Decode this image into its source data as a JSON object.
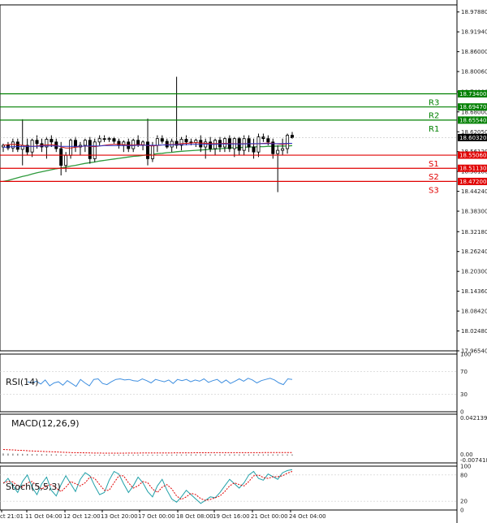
{
  "chart_data": {
    "type": "candlestick",
    "price_ticks": [
      "18.97880",
      "18.91940",
      "18.86000",
      "18.80060",
      "18.74000",
      "18.68000",
      "18.62050",
      "18.56120",
      "18.50180",
      "18.44240",
      "18.38300",
      "18.32180",
      "18.26240",
      "18.20300",
      "18.14360",
      "18.08420",
      "18.02480",
      "17.96540"
    ],
    "price_range": [
      17.9654,
      19.0
    ],
    "current_price": "18.60320",
    "levels": [
      {
        "name": "R3",
        "value": 18.734,
        "label": "18.73400",
        "color": "#008000"
      },
      {
        "name": "R2",
        "value": 18.6947,
        "label": "18.69470",
        "color": "#008000"
      },
      {
        "name": "R1",
        "value": 18.6554,
        "label": "18.65540",
        "color": "#008000"
      },
      {
        "name": "S1",
        "value": 18.5506,
        "label": "18.55060",
        "color": "#e00000"
      },
      {
        "name": "S2",
        "value": 18.5113,
        "label": "18.51130",
        "color": "#e00000"
      },
      {
        "name": "S3",
        "value": 18.472,
        "label": "18.47200",
        "color": "#e00000"
      }
    ],
    "candles": [
      {
        "o": 18.575,
        "h": 18.585,
        "l": 18.56,
        "c": 18.58
      },
      {
        "o": 18.58,
        "h": 18.59,
        "l": 18.565,
        "c": 18.572
      },
      {
        "o": 18.572,
        "h": 18.6,
        "l": 18.56,
        "c": 18.59
      },
      {
        "o": 18.59,
        "h": 18.6,
        "l": 18.56,
        "c": 18.568
      },
      {
        "o": 18.568,
        "h": 18.658,
        "l": 18.52,
        "c": 18.58
      },
      {
        "o": 18.58,
        "h": 18.6,
        "l": 18.55,
        "c": 18.56
      },
      {
        "o": 18.56,
        "h": 18.6,
        "l": 18.545,
        "c": 18.595
      },
      {
        "o": 18.595,
        "h": 18.61,
        "l": 18.57,
        "c": 18.585
      },
      {
        "o": 18.585,
        "h": 18.6,
        "l": 18.56,
        "c": 18.575
      },
      {
        "o": 18.575,
        "h": 18.605,
        "l": 18.54,
        "c": 18.598
      },
      {
        "o": 18.598,
        "h": 18.61,
        "l": 18.575,
        "c": 18.59
      },
      {
        "o": 18.59,
        "h": 18.6,
        "l": 18.56,
        "c": 18.57
      },
      {
        "o": 18.57,
        "h": 18.59,
        "l": 18.49,
        "c": 18.52
      },
      {
        "o": 18.52,
        "h": 18.56,
        "l": 18.5,
        "c": 18.55
      },
      {
        "o": 18.55,
        "h": 18.6,
        "l": 18.54,
        "c": 18.595
      },
      {
        "o": 18.595,
        "h": 18.605,
        "l": 18.56,
        "c": 18.575
      },
      {
        "o": 18.575,
        "h": 18.59,
        "l": 18.55,
        "c": 18.58
      },
      {
        "o": 18.58,
        "h": 18.6,
        "l": 18.56,
        "c": 18.595
      },
      {
        "o": 18.595,
        "h": 18.605,
        "l": 18.525,
        "c": 18.54
      },
      {
        "o": 18.54,
        "h": 18.6,
        "l": 18.53,
        "c": 18.59
      },
      {
        "o": 18.59,
        "h": 18.61,
        "l": 18.58,
        "c": 18.6
      },
      {
        "o": 18.6,
        "h": 18.61,
        "l": 18.59,
        "c": 18.598
      },
      {
        "o": 18.598,
        "h": 18.605,
        "l": 18.59,
        "c": 18.6
      },
      {
        "o": 18.6,
        "h": 18.605,
        "l": 18.585,
        "c": 18.592
      },
      {
        "o": 18.592,
        "h": 18.6,
        "l": 18.57,
        "c": 18.58
      },
      {
        "o": 18.58,
        "h": 18.595,
        "l": 18.56,
        "c": 18.59
      },
      {
        "o": 18.59,
        "h": 18.6,
        "l": 18.56,
        "c": 18.57
      },
      {
        "o": 18.57,
        "h": 18.6,
        "l": 18.56,
        "c": 18.595
      },
      {
        "o": 18.595,
        "h": 18.61,
        "l": 18.575,
        "c": 18.58
      },
      {
        "o": 18.58,
        "h": 18.595,
        "l": 18.565,
        "c": 18.59
      },
      {
        "o": 18.59,
        "h": 18.66,
        "l": 18.52,
        "c": 18.54
      },
      {
        "o": 18.54,
        "h": 18.59,
        "l": 18.53,
        "c": 18.58
      },
      {
        "o": 18.58,
        "h": 18.61,
        "l": 18.56,
        "c": 18.6
      },
      {
        "o": 18.6,
        "h": 18.61,
        "l": 18.585,
        "c": 18.592
      },
      {
        "o": 18.592,
        "h": 18.6,
        "l": 18.57,
        "c": 18.575
      },
      {
        "o": 18.575,
        "h": 18.6,
        "l": 18.56,
        "c": 18.592
      },
      {
        "o": 18.592,
        "h": 18.785,
        "l": 18.57,
        "c": 18.58
      },
      {
        "o": 18.58,
        "h": 18.605,
        "l": 18.565,
        "c": 18.598
      },
      {
        "o": 18.598,
        "h": 18.61,
        "l": 18.58,
        "c": 18.59
      },
      {
        "o": 18.59,
        "h": 18.6,
        "l": 18.58,
        "c": 18.588
      },
      {
        "o": 18.588,
        "h": 18.6,
        "l": 18.575,
        "c": 18.595
      },
      {
        "o": 18.595,
        "h": 18.61,
        "l": 18.56,
        "c": 18.575
      },
      {
        "o": 18.575,
        "h": 18.6,
        "l": 18.54,
        "c": 18.59
      },
      {
        "o": 18.59,
        "h": 18.605,
        "l": 18.56,
        "c": 18.57
      },
      {
        "o": 18.57,
        "h": 18.6,
        "l": 18.55,
        "c": 18.595
      },
      {
        "o": 18.595,
        "h": 18.605,
        "l": 18.56,
        "c": 18.575
      },
      {
        "o": 18.575,
        "h": 18.605,
        "l": 18.56,
        "c": 18.6
      },
      {
        "o": 18.6,
        "h": 18.61,
        "l": 18.56,
        "c": 18.57
      },
      {
        "o": 18.57,
        "h": 18.605,
        "l": 18.545,
        "c": 18.6
      },
      {
        "o": 18.6,
        "h": 18.605,
        "l": 18.55,
        "c": 18.565
      },
      {
        "o": 18.565,
        "h": 18.61,
        "l": 18.55,
        "c": 18.6
      },
      {
        "o": 18.6,
        "h": 18.61,
        "l": 18.56,
        "c": 18.575
      },
      {
        "o": 18.575,
        "h": 18.6,
        "l": 18.54,
        "c": 18.56
      },
      {
        "o": 18.56,
        "h": 18.615,
        "l": 18.545,
        "c": 18.605
      },
      {
        "o": 18.605,
        "h": 18.615,
        "l": 18.59,
        "c": 18.6
      },
      {
        "o": 18.6,
        "h": 18.61,
        "l": 18.58,
        "c": 18.59
      },
      {
        "o": 18.59,
        "h": 18.6,
        "l": 18.54,
        "c": 18.555
      },
      {
        "o": 18.555,
        "h": 18.58,
        "l": 18.44,
        "c": 18.565
      },
      {
        "o": 18.565,
        "h": 18.6,
        "l": 18.55,
        "c": 18.57
      },
      {
        "o": 18.57,
        "h": 18.615,
        "l": 18.555,
        "c": 18.61
      },
      {
        "o": 18.61,
        "h": 18.62,
        "l": 18.6,
        "c": 18.603
      }
    ],
    "ma_fast": [
      18.58,
      18.582,
      18.583,
      18.582,
      18.58,
      18.578,
      18.577,
      18.578,
      18.58,
      18.581,
      18.582,
      18.58,
      18.575,
      18.572,
      18.572,
      18.574,
      18.576,
      18.578,
      18.577,
      18.576,
      18.578,
      18.58,
      18.582,
      18.583,
      18.583,
      18.582,
      18.581,
      18.581,
      18.582,
      18.582,
      18.579,
      18.578,
      18.579,
      18.581,
      18.582,
      18.582,
      18.583,
      18.585,
      18.586,
      18.587,
      18.588,
      18.587,
      18.586,
      18.585,
      18.585,
      18.585,
      18.586,
      18.585,
      18.585,
      18.584,
      18.585,
      18.585,
      18.584,
      18.585,
      18.586,
      18.587,
      18.586,
      18.584,
      18.583,
      18.585,
      18.586
    ],
    "ma_slow": [
      18.574,
      18.575,
      18.576,
      18.576,
      18.577,
      18.577,
      18.577,
      18.577,
      18.578,
      18.578,
      18.578,
      18.578,
      18.577,
      18.577,
      18.577,
      18.577,
      18.577,
      18.578,
      18.578,
      18.578,
      18.578,
      18.579,
      18.579,
      18.579,
      18.579,
      18.579,
      18.579,
      18.579,
      18.58,
      18.58,
      18.58,
      18.58,
      18.58,
      18.581,
      18.581,
      18.581,
      18.582,
      18.582,
      18.582,
      18.583,
      18.583,
      18.583,
      18.583,
      18.583,
      18.583,
      18.584,
      18.584,
      18.584,
      18.584,
      18.584,
      18.584,
      18.585,
      18.585,
      18.585,
      18.585,
      18.585,
      18.585,
      18.585,
      18.585,
      18.586,
      18.586
    ],
    "ma_long": [
      18.472,
      18.475,
      18.479,
      18.483,
      18.487,
      18.49,
      18.494,
      18.498,
      18.501,
      18.504,
      18.507,
      18.51,
      18.512,
      18.515,
      18.518,
      18.52,
      18.523,
      18.526,
      18.528,
      18.53,
      18.533,
      18.535,
      18.537,
      18.539,
      18.541,
      18.543,
      18.545,
      18.547,
      18.548,
      18.55,
      18.552,
      18.553,
      18.555,
      18.556,
      18.558,
      18.559,
      18.561,
      18.562,
      18.563,
      18.564,
      18.565,
      18.566,
      18.567,
      18.568,
      18.569,
      18.57,
      18.571,
      18.572,
      18.573,
      18.573,
      18.574,
      18.575,
      18.575,
      18.576,
      18.576,
      18.577,
      18.577,
      18.578,
      18.578,
      18.578,
      18.579
    ],
    "x_labels": [
      "ct 21:01",
      "11 Oct 04:00",
      "12 Oct 12:00",
      "13 Oct 20:00",
      "17 Oct 00:00",
      "18 Oct 08:00",
      "19 Oct 16:00",
      "21 Oct 00:00",
      "24 Oct 04:00"
    ],
    "rsi": {
      "title": "RSI(14)",
      "ticks": [
        "100",
        "70",
        "30",
        "0"
      ],
      "tick_values": [
        100,
        70,
        30,
        0
      ],
      "values": [
        52,
        50,
        53,
        48,
        55,
        45,
        50,
        52,
        46,
        54,
        49,
        44,
        56,
        50,
        45,
        56,
        57,
        49,
        47,
        52,
        56,
        57,
        55,
        56,
        54,
        53,
        57,
        54,
        50,
        56,
        54,
        52,
        55,
        49,
        56,
        54,
        56,
        52,
        55,
        53,
        57,
        51,
        54,
        56,
        50,
        55,
        49,
        53,
        57,
        53,
        58,
        55,
        50,
        54,
        56,
        58,
        55,
        50,
        47,
        57,
        56
      ]
    },
    "macd": {
      "title": "MACD(12,26,9)",
      "top_label": "0.042139",
      "zero_label": "0.00",
      "bottom_label": "-0.007418",
      "hist": [
        0.0022,
        0.0021,
        0.002,
        0.0019,
        0.0018,
        0.0017,
        0.0016,
        0.0015,
        0.0015,
        0.0014,
        0.0013,
        0.0012,
        0.001,
        0.0009,
        0.0009,
        0.0009,
        0.0009,
        0.0009,
        0.0008,
        0.0008,
        0.0009,
        0.0009,
        0.001,
        0.001,
        0.001,
        0.001,
        0.001,
        0.001,
        0.001,
        0.001,
        0.0009,
        0.0009,
        0.0009,
        0.001,
        0.001,
        0.001,
        0.0011,
        0.0011,
        0.0011,
        0.0012,
        0.0012,
        0.0012,
        0.0012,
        0.0012,
        0.0012,
        0.0012,
        0.0012,
        0.0012,
        0.0012,
        0.0012,
        0.0012,
        0.0012,
        0.0012,
        0.0012,
        0.0012,
        0.0012,
        0.0012,
        0.0012,
        0.0012,
        0.0012,
        0.0012
      ],
      "signal": [
        0.0062,
        0.006,
        0.0058,
        0.0055,
        0.0053,
        0.005,
        0.0047,
        0.0045,
        0.0043,
        0.0041,
        0.0039,
        0.0037,
        0.0035,
        0.0033,
        0.0031,
        0.003,
        0.0029,
        0.0028,
        0.0027,
        0.0026,
        0.0026,
        0.0025,
        0.0025,
        0.0025,
        0.0025,
        0.0025,
        0.0026,
        0.0026,
        0.0026,
        0.0027,
        0.0027,
        0.0027,
        0.0027,
        0.0027,
        0.0027,
        0.0027,
        0.0028,
        0.0028,
        0.0028,
        0.0028,
        0.0029,
        0.0029,
        0.0029,
        0.003,
        0.003,
        0.003,
        0.003,
        0.003,
        0.003,
        0.003,
        0.003,
        0.003,
        0.003,
        0.003,
        0.0031,
        0.0031,
        0.0031,
        0.0031,
        0.0031,
        0.0031,
        0.0031
      ]
    },
    "stoch": {
      "title": "Stoch(5,5,3)",
      "ticks": [
        "100",
        "80",
        "20",
        "0"
      ],
      "tick_values": [
        100,
        80,
        20,
        0
      ],
      "k": [
        60,
        72,
        55,
        40,
        65,
        80,
        52,
        35,
        60,
        75,
        45,
        32,
        58,
        78,
        60,
        42,
        70,
        85,
        78,
        55,
        35,
        40,
        68,
        88,
        82,
        60,
        40,
        55,
        75,
        62,
        42,
        30,
        55,
        70,
        45,
        25,
        18,
        30,
        45,
        35,
        25,
        15,
        22,
        30,
        28,
        40,
        55,
        70,
        60,
        50,
        62,
        80,
        88,
        72,
        68,
        82,
        76,
        70,
        85,
        90,
        92
      ],
      "d": [
        62,
        65,
        64,
        55,
        52,
        62,
        65,
        55,
        48,
        55,
        58,
        50,
        42,
        52,
        65,
        60,
        55,
        62,
        75,
        72,
        58,
        45,
        45,
        62,
        78,
        78,
        62,
        50,
        55,
        65,
        62,
        48,
        40,
        52,
        58,
        48,
        32,
        24,
        30,
        38,
        35,
        26,
        22,
        24,
        28,
        32,
        42,
        55,
        62,
        58,
        55,
        65,
        78,
        80,
        74,
        72,
        76,
        76,
        78,
        84,
        88
      ]
    }
  }
}
